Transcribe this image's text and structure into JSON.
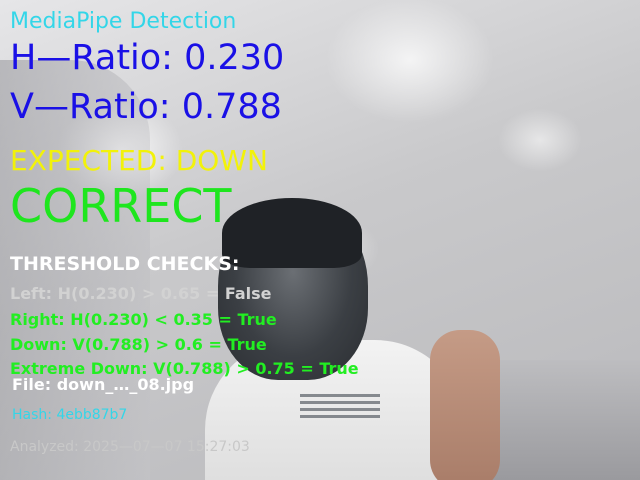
{
  "overlay": {
    "title": "MediaPipe Detection",
    "h_ratio": "H—Ratio: 0.230",
    "v_ratio": "V—Ratio: 0.788",
    "expected": "EXPECTED: DOWN",
    "result": "CORRECT",
    "threshold_header": "THRESHOLD CHECKS:",
    "checks": [
      "Left: H(0.230) > 0.65 = False",
      "Right: H(0.230) < 0.35 = True",
      "Down: V(0.788) > 0.6 = True",
      "Extreme Down: V(0.788) > 0.75 = True"
    ],
    "file": "File: down_…_08.jpg",
    "hash": "Hash: 4ebb87b7",
    "analyzed": "Analyzed: 2025—07—07 15:27:03"
  },
  "colors": {
    "title": "#33d6e8",
    "ratios": "#1a10e6",
    "expected": "#f2f20a",
    "correct": "#1ee61e",
    "check_false": "#d2d2d2",
    "check_true": "#22ee22"
  }
}
